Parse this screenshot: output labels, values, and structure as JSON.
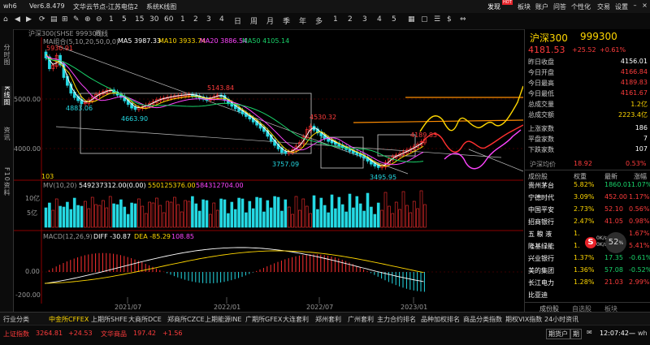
{
  "window": {
    "app_name": "wh6",
    "version": "Ver6.8.479",
    "node": "文华云节点-江苏电信2",
    "system": "系统K线图"
  },
  "top_menu": [
    "发现",
    "板块",
    "账户",
    "问答",
    "个性化",
    "交易",
    "设置"
  ],
  "hot_badge": "HOT",
  "toolbar_tools": [
    "1",
    "5",
    "15",
    "30",
    "60",
    "1",
    "2",
    "3",
    "4",
    "日",
    "周",
    "月",
    "季",
    "年",
    "多",
    "1",
    "2",
    "3",
    "4",
    "5"
  ],
  "chart_header": {
    "ticker": "沪深300(SHSE 999300)",
    "period": "周线"
  },
  "ma_legend": {
    "label": "MA组合(5,10,20,50,0,0)",
    "ma5": "MA5 3987.33",
    "ma10": "MA10 3933.74",
    "ma20": "MA20 3886.54",
    "ma50": "MA50 4105.14",
    "colors": {
      "ma5": "#ffffff",
      "ma10": "#ffd700",
      "ma20": "#ff44ff",
      "ma50": "#19d36a"
    }
  },
  "price_annotations": {
    "high_left": "5930.91",
    "low_a": "4883.06",
    "low_b": "4663.90",
    "peak_mid": "5143.84",
    "low_c": "3757.09",
    "peak_c": "4530.32",
    "peak_d": "4189.83",
    "low_d": "3495.95",
    "bar_count": "103"
  },
  "price_axis": [
    "5000.00",
    "4000.00"
  ],
  "vol_legend": {
    "label": "MV(10,20)",
    "v1": "549237312.00(0.00)",
    "v2": "550125376.00",
    "v3": "584312704.00"
  },
  "vol_axis": [
    "10亿",
    "5亿"
  ],
  "macd_legend": {
    "label": "MACD(12,26,9)",
    "diff": "DIFF -30.87",
    "dea": "DEA -85.29",
    "macd": "108.85"
  },
  "macd_axis": [
    "0.00",
    "-200.00"
  ],
  "time_axis": [
    "2021/07",
    "2022/01",
    "2022/07",
    "2023/01"
  ],
  "left_tabs": [
    "分时图",
    "K线图",
    "资讯",
    "F10资料"
  ],
  "quote": {
    "name": "沪深300",
    "code": "999300",
    "last": "4181.53",
    "change": "+25.52",
    "pct": "+0.61%",
    "rows": [
      {
        "k": "昨日收盘",
        "v": "4156.01",
        "c": "white"
      },
      {
        "k": "今日开盘",
        "v": "4166.84",
        "c": "red"
      },
      {
        "k": "今日最高",
        "v": "4189.83",
        "c": "red"
      },
      {
        "k": "今日最低",
        "v": "4161.67",
        "c": "red"
      },
      {
        "k": "总成交量",
        "v": "1.2亿",
        "c": "yellow"
      },
      {
        "k": "总成交额",
        "v": "2223.4亿",
        "c": "yellow"
      },
      {
        "k": "上涨家数",
        "v": "186",
        "c": "white"
      },
      {
        "k": "平盘家数",
        "v": "7",
        "c": "white"
      },
      {
        "k": "下跌家数",
        "v": "107",
        "c": "white"
      }
    ],
    "avg_label": "沪深均价",
    "avg_value": "18.92",
    "avg_pct": "0.53%"
  },
  "components": {
    "headers": [
      "成份股",
      "权重",
      "最新",
      "涨幅"
    ],
    "rows": [
      {
        "name": "贵州茅台",
        "w": "5.82%",
        "p": "1860.01",
        "chg": "-1.07%",
        "up": false
      },
      {
        "name": "宁德时代",
        "w": "3.09%",
        "p": "452.00",
        "chg": "1.17%",
        "up": true
      },
      {
        "name": "中国平安",
        "w": "2.73%",
        "p": "52.10",
        "chg": "0.56%",
        "up": true
      },
      {
        "name": "招商银行",
        "w": "2.47%",
        "p": "41.05",
        "chg": "0.98%",
        "up": true
      },
      {
        "name": "五 粮 液",
        "w": "1.",
        "p": "",
        "chg": "1.67%",
        "up": true
      },
      {
        "name": "隆基绿能",
        "w": "1.",
        "p": "",
        "chg": "5.41%",
        "up": true
      },
      {
        "name": "兴业银行",
        "w": "1.37%",
        "p": "17.35",
        "chg": "-0.61%",
        "up": false
      },
      {
        "name": "美的集团",
        "w": "1.36%",
        "p": "57.08",
        "chg": "-0.52%",
        "up": false
      },
      {
        "name": "长江电力",
        "w": "1.28%",
        "p": "21.03",
        "chg": "2.99%",
        "up": true
      },
      {
        "name": "比亚迪",
        "w": "",
        "p": "",
        "chg": "",
        "up": true
      }
    ],
    "footer_tabs": [
      "成份股",
      "自选股",
      "板块"
    ]
  },
  "speed_badge": {
    "value": "52",
    "unit": "%",
    "up": "0K/s",
    "down": "0K/s"
  },
  "s_logo": "S",
  "bottom_tabs": [
    "行业分类",
    "中金所CFFEX",
    "上期所SHFE",
    "大商所DCE",
    "郑商所CZCE",
    "上期能源INE",
    "广期所GFEX",
    "大连套利",
    "郑州套利",
    "广州套利",
    "主力合约排名",
    "品种加权排名",
    "商品分类指数",
    "期权VIX指数",
    "24小时资讯"
  ],
  "status": {
    "sh_label": "上证指数",
    "sh_value": "3264.81",
    "sh_chg": "+24.53",
    "cm_label": "文华商品",
    "cm_value": "197.42",
    "cm_chg": "+1.56",
    "buttons": [
      "期货户",
      "期"
    ],
    "time": "12:07:42",
    "weekday": "一",
    "user": "wh"
  }
}
